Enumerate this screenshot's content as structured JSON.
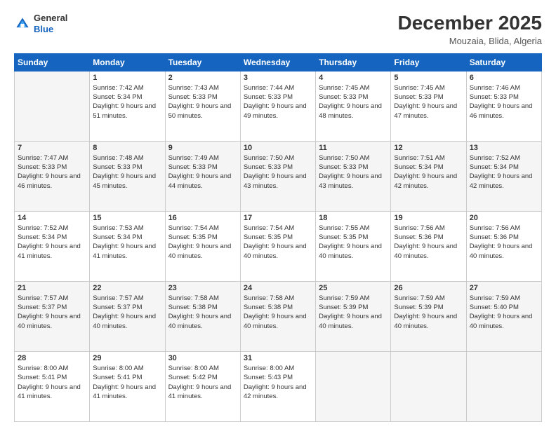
{
  "header": {
    "logo_general": "General",
    "logo_blue": "Blue",
    "month": "December 2025",
    "location": "Mouzaia, Blida, Algeria"
  },
  "weekdays": [
    "Sunday",
    "Monday",
    "Tuesday",
    "Wednesday",
    "Thursday",
    "Friday",
    "Saturday"
  ],
  "weeks": [
    [
      {
        "day": "",
        "sunrise": "",
        "sunset": "",
        "daylight": ""
      },
      {
        "day": "1",
        "sunrise": "Sunrise: 7:42 AM",
        "sunset": "Sunset: 5:34 PM",
        "daylight": "Daylight: 9 hours and 51 minutes."
      },
      {
        "day": "2",
        "sunrise": "Sunrise: 7:43 AM",
        "sunset": "Sunset: 5:33 PM",
        "daylight": "Daylight: 9 hours and 50 minutes."
      },
      {
        "day": "3",
        "sunrise": "Sunrise: 7:44 AM",
        "sunset": "Sunset: 5:33 PM",
        "daylight": "Daylight: 9 hours and 49 minutes."
      },
      {
        "day": "4",
        "sunrise": "Sunrise: 7:45 AM",
        "sunset": "Sunset: 5:33 PM",
        "daylight": "Daylight: 9 hours and 48 minutes."
      },
      {
        "day": "5",
        "sunrise": "Sunrise: 7:45 AM",
        "sunset": "Sunset: 5:33 PM",
        "daylight": "Daylight: 9 hours and 47 minutes."
      },
      {
        "day": "6",
        "sunrise": "Sunrise: 7:46 AM",
        "sunset": "Sunset: 5:33 PM",
        "daylight": "Daylight: 9 hours and 46 minutes."
      }
    ],
    [
      {
        "day": "7",
        "sunrise": "Sunrise: 7:47 AM",
        "sunset": "Sunset: 5:33 PM",
        "daylight": "Daylight: 9 hours and 46 minutes."
      },
      {
        "day": "8",
        "sunrise": "Sunrise: 7:48 AM",
        "sunset": "Sunset: 5:33 PM",
        "daylight": "Daylight: 9 hours and 45 minutes."
      },
      {
        "day": "9",
        "sunrise": "Sunrise: 7:49 AM",
        "sunset": "Sunset: 5:33 PM",
        "daylight": "Daylight: 9 hours and 44 minutes."
      },
      {
        "day": "10",
        "sunrise": "Sunrise: 7:50 AM",
        "sunset": "Sunset: 5:33 PM",
        "daylight": "Daylight: 9 hours and 43 minutes."
      },
      {
        "day": "11",
        "sunrise": "Sunrise: 7:50 AM",
        "sunset": "Sunset: 5:33 PM",
        "daylight": "Daylight: 9 hours and 43 minutes."
      },
      {
        "day": "12",
        "sunrise": "Sunrise: 7:51 AM",
        "sunset": "Sunset: 5:34 PM",
        "daylight": "Daylight: 9 hours and 42 minutes."
      },
      {
        "day": "13",
        "sunrise": "Sunrise: 7:52 AM",
        "sunset": "Sunset: 5:34 PM",
        "daylight": "Daylight: 9 hours and 42 minutes."
      }
    ],
    [
      {
        "day": "14",
        "sunrise": "Sunrise: 7:52 AM",
        "sunset": "Sunset: 5:34 PM",
        "daylight": "Daylight: 9 hours and 41 minutes."
      },
      {
        "day": "15",
        "sunrise": "Sunrise: 7:53 AM",
        "sunset": "Sunset: 5:34 PM",
        "daylight": "Daylight: 9 hours and 41 minutes."
      },
      {
        "day": "16",
        "sunrise": "Sunrise: 7:54 AM",
        "sunset": "Sunset: 5:35 PM",
        "daylight": "Daylight: 9 hours and 40 minutes."
      },
      {
        "day": "17",
        "sunrise": "Sunrise: 7:54 AM",
        "sunset": "Sunset: 5:35 PM",
        "daylight": "Daylight: 9 hours and 40 minutes."
      },
      {
        "day": "18",
        "sunrise": "Sunrise: 7:55 AM",
        "sunset": "Sunset: 5:35 PM",
        "daylight": "Daylight: 9 hours and 40 minutes."
      },
      {
        "day": "19",
        "sunrise": "Sunrise: 7:56 AM",
        "sunset": "Sunset: 5:36 PM",
        "daylight": "Daylight: 9 hours and 40 minutes."
      },
      {
        "day": "20",
        "sunrise": "Sunrise: 7:56 AM",
        "sunset": "Sunset: 5:36 PM",
        "daylight": "Daylight: 9 hours and 40 minutes."
      }
    ],
    [
      {
        "day": "21",
        "sunrise": "Sunrise: 7:57 AM",
        "sunset": "Sunset: 5:37 PM",
        "daylight": "Daylight: 9 hours and 40 minutes."
      },
      {
        "day": "22",
        "sunrise": "Sunrise: 7:57 AM",
        "sunset": "Sunset: 5:37 PM",
        "daylight": "Daylight: 9 hours and 40 minutes."
      },
      {
        "day": "23",
        "sunrise": "Sunrise: 7:58 AM",
        "sunset": "Sunset: 5:38 PM",
        "daylight": "Daylight: 9 hours and 40 minutes."
      },
      {
        "day": "24",
        "sunrise": "Sunrise: 7:58 AM",
        "sunset": "Sunset: 5:38 PM",
        "daylight": "Daylight: 9 hours and 40 minutes."
      },
      {
        "day": "25",
        "sunrise": "Sunrise: 7:59 AM",
        "sunset": "Sunset: 5:39 PM",
        "daylight": "Daylight: 9 hours and 40 minutes."
      },
      {
        "day": "26",
        "sunrise": "Sunrise: 7:59 AM",
        "sunset": "Sunset: 5:39 PM",
        "daylight": "Daylight: 9 hours and 40 minutes."
      },
      {
        "day": "27",
        "sunrise": "Sunrise: 7:59 AM",
        "sunset": "Sunset: 5:40 PM",
        "daylight": "Daylight: 9 hours and 40 minutes."
      }
    ],
    [
      {
        "day": "28",
        "sunrise": "Sunrise: 8:00 AM",
        "sunset": "Sunset: 5:41 PM",
        "daylight": "Daylight: 9 hours and 41 minutes."
      },
      {
        "day": "29",
        "sunrise": "Sunrise: 8:00 AM",
        "sunset": "Sunset: 5:41 PM",
        "daylight": "Daylight: 9 hours and 41 minutes."
      },
      {
        "day": "30",
        "sunrise": "Sunrise: 8:00 AM",
        "sunset": "Sunset: 5:42 PM",
        "daylight": "Daylight: 9 hours and 41 minutes."
      },
      {
        "day": "31",
        "sunrise": "Sunrise: 8:00 AM",
        "sunset": "Sunset: 5:43 PM",
        "daylight": "Daylight: 9 hours and 42 minutes."
      },
      {
        "day": "",
        "sunrise": "",
        "sunset": "",
        "daylight": ""
      },
      {
        "day": "",
        "sunrise": "",
        "sunset": "",
        "daylight": ""
      },
      {
        "day": "",
        "sunrise": "",
        "sunset": "",
        "daylight": ""
      }
    ]
  ]
}
